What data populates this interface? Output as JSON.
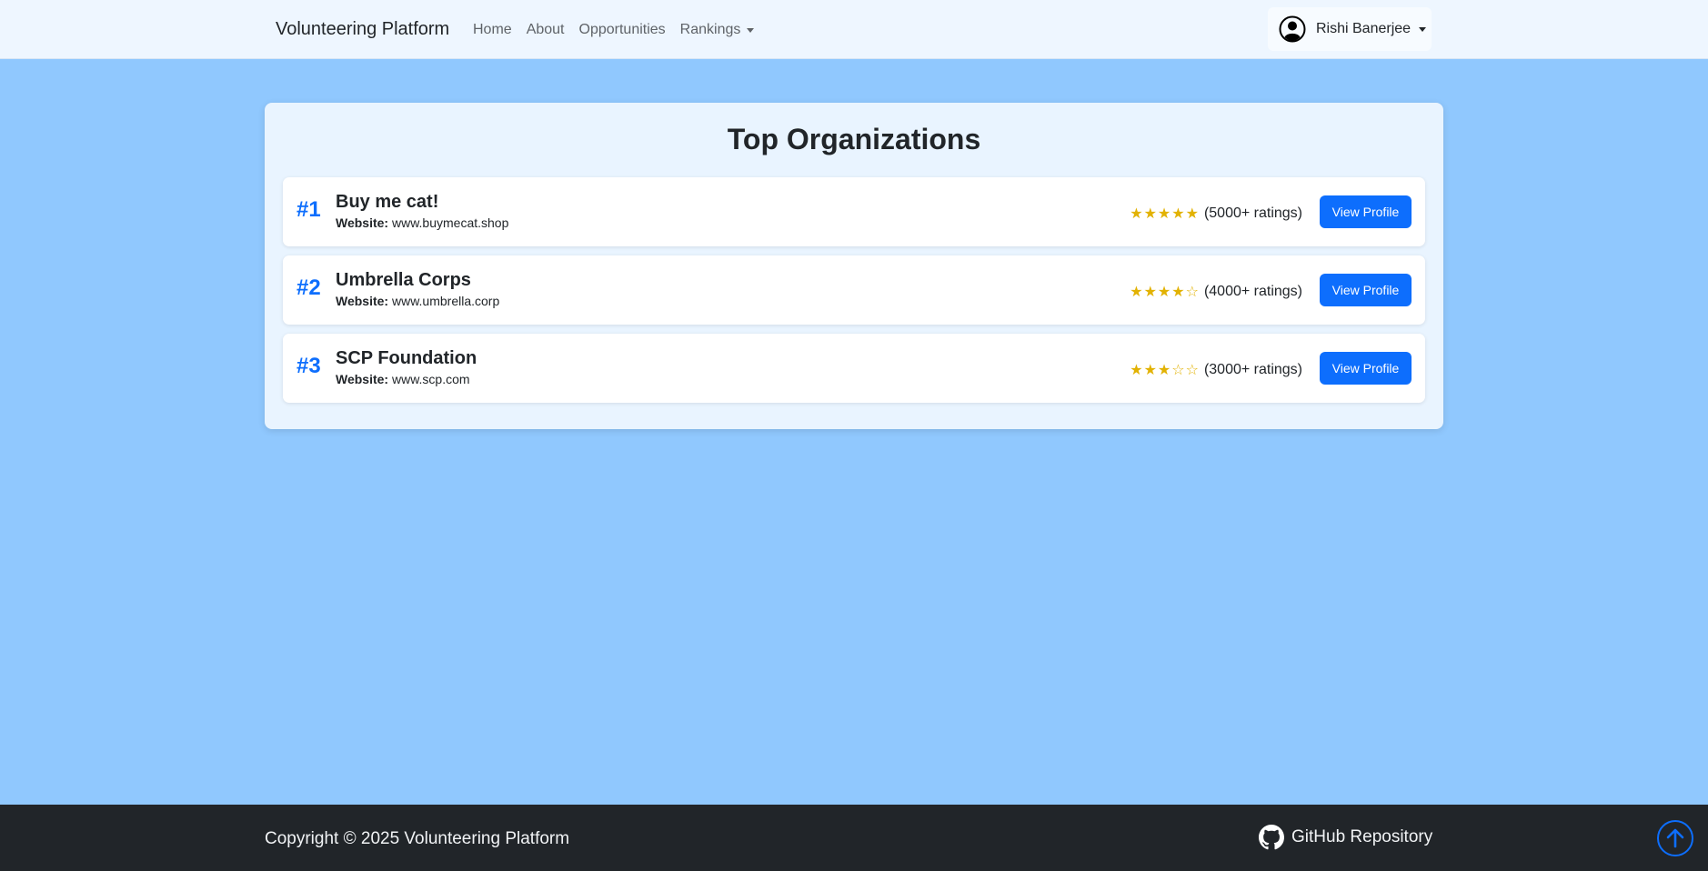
{
  "navbar": {
    "brand": "Volunteering Platform",
    "links": [
      {
        "label": "Home"
      },
      {
        "label": "About"
      },
      {
        "label": "Opportunities"
      },
      {
        "label": "Rankings"
      }
    ],
    "user": {
      "name": "Rishi Banerjee",
      "icon": "user-circle-icon"
    }
  },
  "main": {
    "title": "Top Organizations",
    "website_label": "Website:",
    "button_label": "View Profile",
    "organizations": [
      {
        "rank": "#1",
        "name": "Buy me cat!",
        "website": "www.buymecat.shop",
        "rating": 5,
        "stars": "★★★★★",
        "ratings_text": "(5000+ ratings)"
      },
      {
        "rank": "#2",
        "name": "Umbrella Corps",
        "website": "www.umbrella.corp",
        "rating": 4,
        "stars": "★★★★☆",
        "ratings_text": "(4000+ ratings)"
      },
      {
        "rank": "#3",
        "name": "SCP Foundation",
        "website": "www.scp.com",
        "rating": 3,
        "stars": "★★★☆☆",
        "ratings_text": "(3000+ ratings)"
      }
    ]
  },
  "footer": {
    "copyright": "Copyright © 2025 Volunteering Platform",
    "github_label": "GitHub Repository",
    "github_icon": "github-icon",
    "scroll_top_icon": "arrow-up-circle-icon"
  },
  "colors": {
    "page_bg": "#90c8fe",
    "accent": "#0d6efd",
    "star": "#e2b203",
    "footer_bg": "#212529"
  }
}
